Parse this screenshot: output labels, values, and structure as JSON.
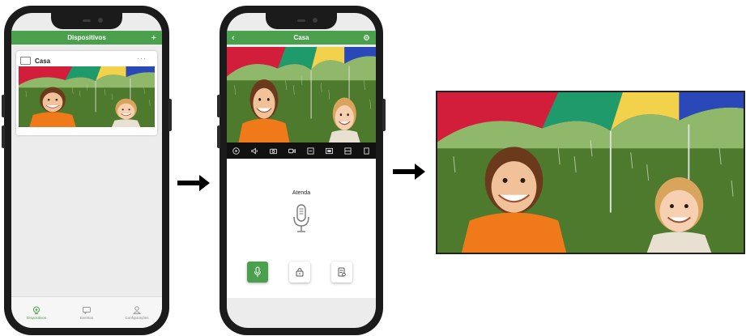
{
  "phone1": {
    "header_title": "Dispositivos",
    "add_symbol": "+",
    "device_card": {
      "name": "Casa",
      "more_symbol": "···"
    },
    "bottom_nav": [
      {
        "label": "Dispositivos",
        "icon": "camera-icon",
        "active": true
      },
      {
        "label": "Eventos",
        "icon": "message-icon",
        "active": false
      },
      {
        "label": "Configurações",
        "icon": "user-icon",
        "active": false
      }
    ]
  },
  "phone2": {
    "header_title": "Casa",
    "back_symbol": "‹",
    "toolbar_icons": [
      "play-icon",
      "volume-icon",
      "camera-icon",
      "video-record-icon",
      "screen-icon",
      "hd-icon",
      "layout-icon",
      "fullscreen-icon"
    ],
    "call_label": "Atenda",
    "actions": [
      "microphone-icon",
      "lock-icon",
      "document-icon"
    ]
  },
  "colors": {
    "accent": "#4aa04c",
    "toolbar": "#111111"
  }
}
